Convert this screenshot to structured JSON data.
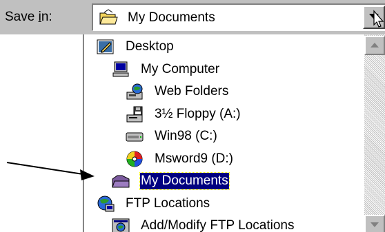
{
  "save_in": {
    "label": "Save in:",
    "selected_value": "My Documents"
  },
  "dropdown": {
    "items": [
      {
        "label": "Desktop",
        "icon": "desktop-icon",
        "indent": 0
      },
      {
        "label": "My Computer",
        "icon": "my-computer-icon",
        "indent": 1
      },
      {
        "label": "Web Folders",
        "icon": "web-folders-icon",
        "indent": 2
      },
      {
        "label": "3½ Floppy (A:)",
        "icon": "floppy-drive-icon",
        "indent": 2
      },
      {
        "label": "Win98 (C:)",
        "icon": "hard-drive-icon",
        "indent": 2
      },
      {
        "label": "Msword9 (D:)",
        "icon": "cd-drive-icon",
        "indent": 2
      },
      {
        "label": "My Documents",
        "icon": "my-documents-folder-icon",
        "indent": 1,
        "selected": true
      },
      {
        "label": "FTP Locations",
        "icon": "ftp-locations-icon",
        "indent": 0
      },
      {
        "label": "Add/Modify FTP Locations",
        "icon": "add-modify-ftp-icon",
        "indent": 1
      }
    ]
  },
  "colors": {
    "selection_bg": "#000080",
    "selection_text": "#ffffff",
    "chrome": "#c0c0c0"
  }
}
